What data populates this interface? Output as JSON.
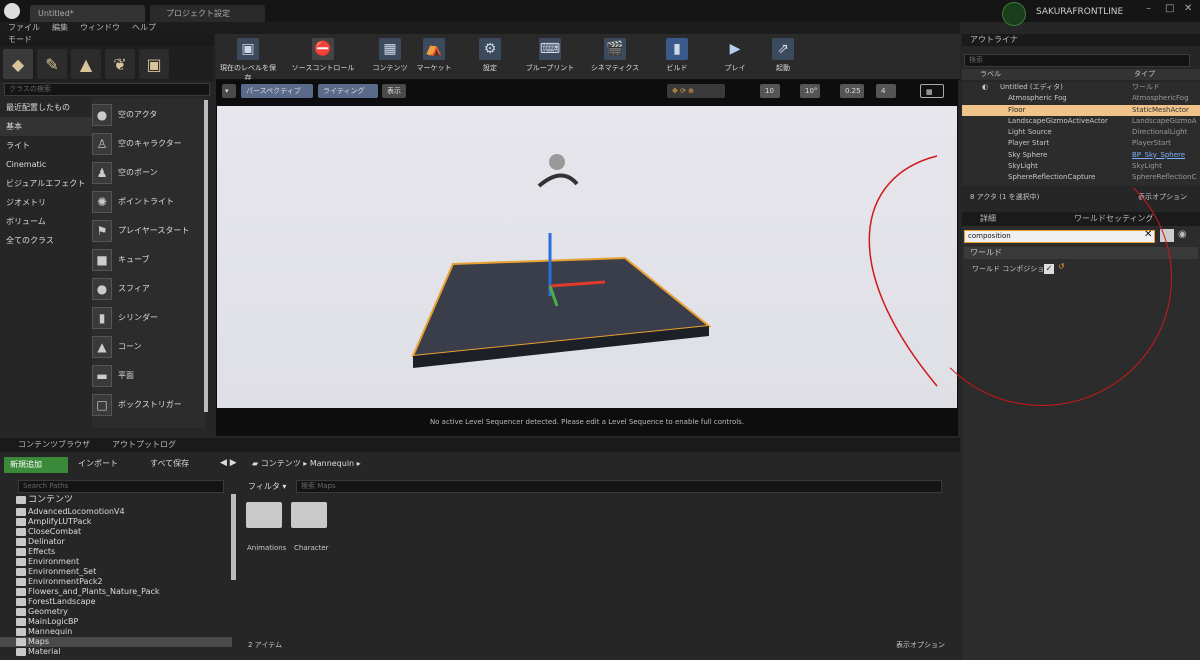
{
  "titlebar": {
    "tab1": "Untitled*",
    "tab2": "プロジェクト設定",
    "brand": "SAKURAFRONTLINE"
  },
  "menu": [
    "ファイル",
    "編集",
    "ウィンドウ",
    "ヘルプ"
  ],
  "modes": {
    "header": "モード",
    "search_placeholder": "クラスの検索",
    "categories": [
      "最近配置したもの",
      "基本",
      "ライト",
      "Cinematic",
      "ビジュアルエフェクト",
      "ジオメトリ",
      "ボリューム",
      "全てのクラス"
    ],
    "items": [
      "空のアクタ",
      "空のキャラクター",
      "空のポーン",
      "ポイントライト",
      "プレイヤースタート",
      "キューブ",
      "スフィア",
      "シリンダー",
      "コーン",
      "平面",
      "ボックストリガー"
    ]
  },
  "toolbar": [
    "現在のレベルを保存",
    "ソースコントロール",
    "コンテンツ",
    "マーケット",
    "設定",
    "ブループリント",
    "シネマティクス",
    "ビルド",
    "プレイ",
    "起動"
  ],
  "viewport": {
    "perspective": "パースペクティブ",
    "lighting": "ライティング",
    "show": "表示",
    "grid": "10",
    "angle": "10°",
    "scale": "0.25",
    "cam": "4",
    "message": "No active Level Sequencer detected. Please edit a Level Sequence to enable full controls."
  },
  "outliner": {
    "header": "アウトライナ",
    "search_placeholder": "検索",
    "col_label": "ラベル",
    "col_type": "タイプ",
    "rows": [
      {
        "label": "Untitled (エディタ)",
        "type": "ワールド"
      },
      {
        "label": "Atmospheric Fog",
        "type": "AtmosphericFog"
      },
      {
        "label": "Floor",
        "type": "StaticMeshActor"
      },
      {
        "label": "LandscapeGizmoActiveActor",
        "type": "LandscapeGizmoA"
      },
      {
        "label": "Light Source",
        "type": "DirectionalLight"
      },
      {
        "label": "Player Start",
        "type": "PlayerStart"
      },
      {
        "label": "Sky Sphere",
        "type": "BP_Sky_Sphere"
      },
      {
        "label": "SkyLight",
        "type": "SkyLight"
      },
      {
        "label": "SphereReflectionCapture",
        "type": "SphereReflectionC"
      }
    ],
    "count": "8 アクタ (1 を選択中)",
    "view_options": "表示オプション"
  },
  "details": {
    "tab1": "詳細",
    "tab2": "ワールドセッティング",
    "search": "composition",
    "section": "ワールド",
    "prop": "ワールド コンポジション"
  },
  "content": {
    "tab1": "コンテンツブラウザ",
    "tab2": "アウトプットログ",
    "add": "新規追加",
    "import": "インポート",
    "save": "すべて保存",
    "path1": "コンテンツ",
    "path2": "Mannequin",
    "search_paths": "Search Paths",
    "filter": "フィルタ",
    "search_maps": "検索 Maps",
    "root": "コンテンツ",
    "folders": [
      "AdvancedLocomotionV4",
      "AmplifyLUTPack",
      "CloseCombat",
      "Delinator",
      "Effects",
      "Environment",
      "Environment_Set",
      "EnvironmentPack2",
      "Flowers_and_Plants_Nature_Pack",
      "ForestLandscape",
      "Geometry",
      "MainLogicBP",
      "Mannequin",
      "Maps",
      "Material"
    ],
    "assets": [
      "Animations",
      "Character"
    ],
    "items_count": "2 アイテム",
    "view_options": "表示オプション"
  }
}
